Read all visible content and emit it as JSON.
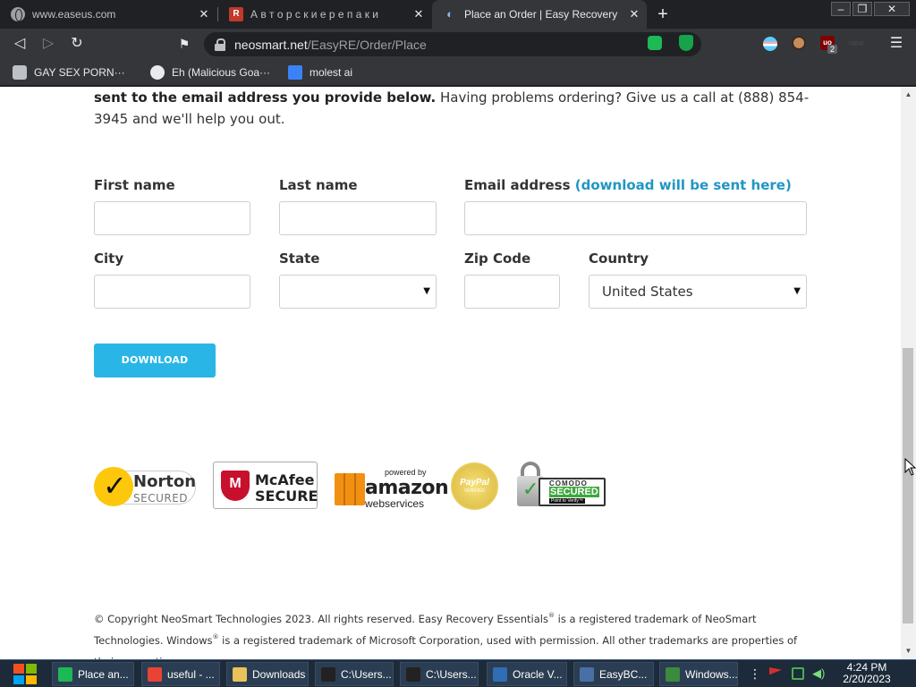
{
  "browser": {
    "tabs": [
      {
        "title": "www.easeus.com",
        "icon": "globe-icon",
        "active": false
      },
      {
        "title": "А в т о р с к и е  р е п а к и",
        "icon": "r-logo-icon",
        "active": false
      },
      {
        "title": "Place an Order | Easy Recovery",
        "icon": "eye-icon",
        "active": true
      }
    ],
    "url_host": "neosmart.net",
    "url_path": "/EasyRE/Order/Place",
    "bookmarks": [
      {
        "label": "GAY SEX PORN···",
        "icon": "puzzle-icon"
      },
      {
        "label": "Eh (Malicious Goa···",
        "icon": "globe-icon"
      },
      {
        "label": "molest ai",
        "icon": "app-icon"
      }
    ],
    "ublock_badge": "2",
    "faded_ext_label": "new"
  },
  "page": {
    "intro_bold": "sent to the email address you provide below.",
    "intro_rest": " Having problems ordering? Give us a call at (888) 854-3945 and we'll help you out.",
    "form": {
      "first_name_label": "First name",
      "last_name_label": "Last name",
      "email_label": "Email address",
      "email_hint": "(download will be sent here)",
      "city_label": "City",
      "state_label": "State",
      "zip_label": "Zip Code",
      "country_label": "Country",
      "first_name_value": "",
      "last_name_value": "",
      "email_value": "",
      "city_value": "",
      "state_value": "",
      "zip_value": "",
      "country_value": "United States"
    },
    "download_label": "DOWNLOAD",
    "badges": {
      "norton_line1": "Norton",
      "norton_line2": "SECURED",
      "mcafee_line1": "McAfee",
      "mcafee_line2": "SECURE",
      "aws_line0": "powered by",
      "aws_line1": "amazon",
      "aws_line2": "webservices",
      "paypal_line1": "PayPal",
      "paypal_line2": "VERIFIED",
      "comodo_line1": "COMODO",
      "comodo_line2": "SECURED",
      "comodo_line3": "Point to Verify™"
    },
    "footer_a": "© Copyright NeoSmart Technologies 2023. All rights reserved. Easy Recovery Essentials",
    "footer_b": " is a registered trademark of NeoSmart Technologies. Windows",
    "footer_c": " is a registered trademark of Microsoft Corporation, used with permission. All other trademarks are properties of their respective owners.",
    "registered_mark": "®"
  },
  "taskbar": {
    "items": [
      {
        "label": "Place an...",
        "color": "#1db954"
      },
      {
        "label": "useful - ...",
        "color": "#e94335"
      },
      {
        "label": "Downloads",
        "color": "#e8c25a"
      },
      {
        "label": "C:\\Users...",
        "color": "#222222"
      },
      {
        "label": "C:\\Users...",
        "color": "#222222"
      },
      {
        "label": "Oracle V...",
        "color": "#2f6db5"
      },
      {
        "label": "EasyBC...",
        "color": "#4a6fa5"
      },
      {
        "label": "Windows...",
        "color": "#3c8a3c"
      }
    ],
    "time": "4:24 PM",
    "date": "2/20/2023"
  },
  "colors": {
    "accent": "#29b6e6",
    "hint": "#2196c4"
  }
}
